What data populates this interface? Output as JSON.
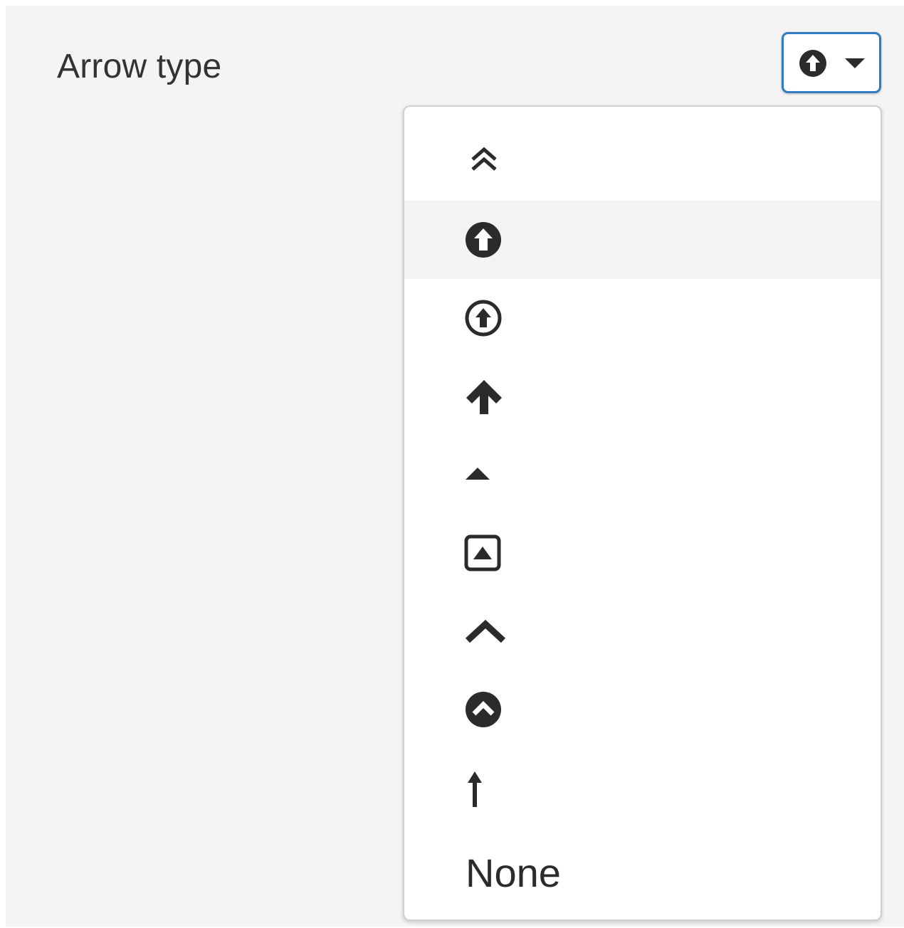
{
  "field": {
    "label": "Arrow type"
  },
  "select": {
    "current_icon": "circle-arrow-up-filled-icon",
    "accent_color": "#2f7bc4"
  },
  "menu": {
    "selected_index": 1,
    "options": [
      {
        "icon": "double-chevron-up-icon"
      },
      {
        "icon": "circle-arrow-up-filled-icon"
      },
      {
        "icon": "circle-arrow-up-outline-icon"
      },
      {
        "icon": "bold-arrow-up-icon"
      },
      {
        "icon": "caret-up-icon"
      },
      {
        "icon": "square-caret-up-icon"
      },
      {
        "icon": "chevron-up-icon"
      },
      {
        "icon": "circle-chevron-up-icon"
      },
      {
        "icon": "long-arrow-up-icon"
      },
      {
        "label": "None"
      }
    ]
  },
  "colors": {
    "icon": "#2b2b2b",
    "panel_background": "#f4f4f4",
    "selected_background": "#f3f3f3"
  }
}
